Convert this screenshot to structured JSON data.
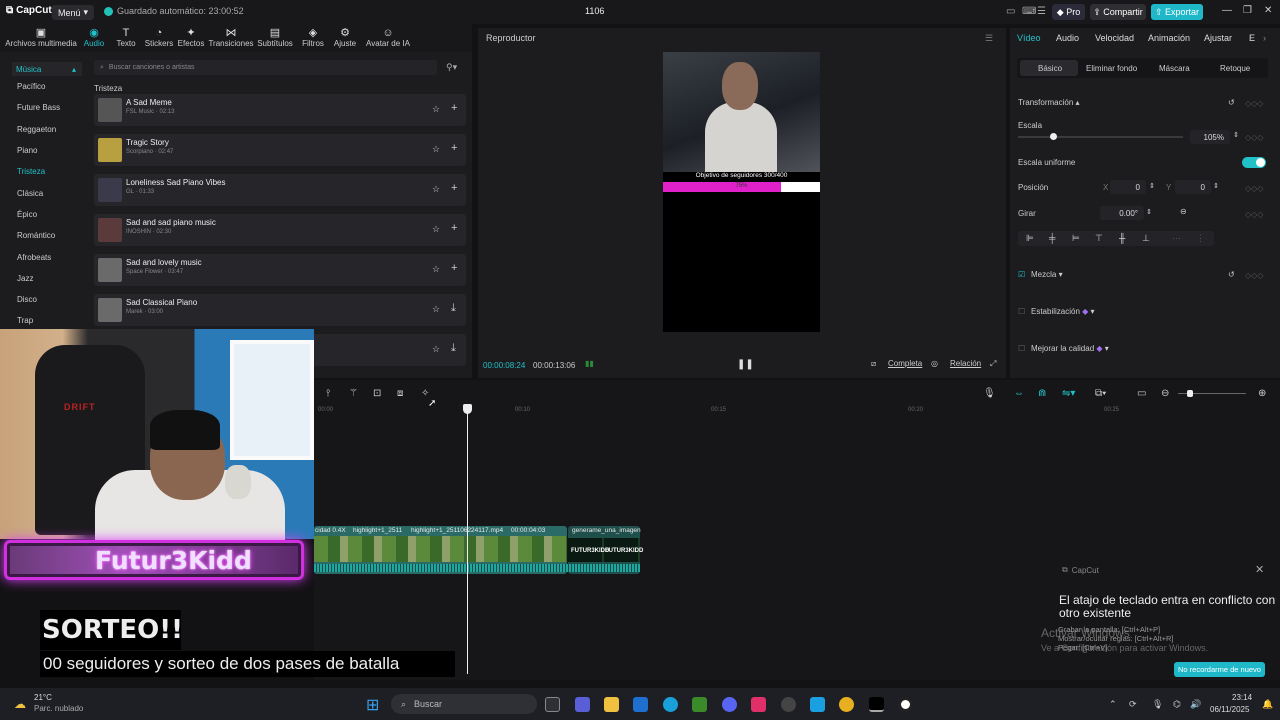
{
  "app": {
    "logo": "CapCut",
    "menu_label": "Menú",
    "autosave": "Guardado automático: 23:00:52",
    "project_title": "1106",
    "pro_label": "Pro",
    "share_label": "Compartir",
    "export_label": "Exportar",
    "accent": "#22c1c8"
  },
  "toolbar": {
    "items": [
      {
        "label": "Archivos multimedia",
        "icon": "media-icon"
      },
      {
        "label": "Audio",
        "icon": "audio-icon"
      },
      {
        "label": "Texto",
        "icon": "text-icon"
      },
      {
        "label": "Stickers",
        "icon": "sticker-icon"
      },
      {
        "label": "Efectos",
        "icon": "effects-icon"
      },
      {
        "label": "Transiciones",
        "icon": "transitions-icon"
      },
      {
        "label": "Subtítulos",
        "icon": "subtitles-icon"
      },
      {
        "label": "Filtros",
        "icon": "filters-icon"
      },
      {
        "label": "Ajuste",
        "icon": "adjust-icon"
      },
      {
        "label": "Avatar de IA",
        "icon": "ai-avatar-icon"
      }
    ]
  },
  "sidebar": {
    "music_label": "Música",
    "categories": [
      "Pacífico",
      "Future Bass",
      "Reggaeton",
      "Piano",
      "Tristeza",
      "Clásica",
      "Épico",
      "Romántico",
      "Afrobeats",
      "Jazz",
      "Disco",
      "Trap"
    ]
  },
  "library": {
    "search_placeholder": "Buscar canciones o artistas",
    "section": "Tristeza",
    "tracks": [
      {
        "title": "A Sad Meme",
        "meta": "FSL Music · 02:13"
      },
      {
        "title": "Tragic Story",
        "meta": "Scorpiano · 02:47"
      },
      {
        "title": "Loneliness Sad Piano Vibes",
        "meta": "GL · 01:33"
      },
      {
        "title": "Sad and sad piano music",
        "meta": "INOSHIN · 02:30"
      },
      {
        "title": "Sad and lovely music",
        "meta": "Space Flower · 03:47"
      },
      {
        "title": "Sad Classical Piano",
        "meta": "Marek · 03:00"
      }
    ]
  },
  "player": {
    "title": "Reproductor",
    "overlay_goal": "Objetivo de seguidores 300/400",
    "goal_progress": 0.75,
    "goal_percent": "75%",
    "time_current": "00:00:08:24",
    "time_total": "00:00:13:06",
    "btn_complete": "Completa",
    "btn_ratio": "Relación"
  },
  "inspector": {
    "tabs": [
      "Vídeo",
      "Audio",
      "Velocidad",
      "Animación",
      "Ajustar",
      "E"
    ],
    "subtabs": [
      "Básico",
      "Eliminar fondo",
      "Máscara",
      "Retoque"
    ],
    "transform_label": "Transformación",
    "scale_label": "Escala",
    "scale_value": "105%",
    "uniform_scale_label": "Escala uniforme",
    "position_label": "Posición",
    "pos_x_label": "X",
    "pos_x": "0",
    "pos_y_label": "Y",
    "pos_y": "0",
    "rotate_label": "Girar",
    "rotate_value": "0.00°",
    "blend_label": "Mezcla",
    "stabilize_label": "Estabilización",
    "quality_label": "Mejorar la calidad"
  },
  "timeline": {
    "ruler": [
      "00:00",
      "00:10",
      "00:15",
      "00:20",
      "00:25"
    ],
    "clip_labels": [
      "cidad 0.4X",
      "highlight+1_2511",
      "highlight+1_251106224117.mp4",
      "00:00:04:03",
      "generame_una_imagen"
    ]
  },
  "overlay": {
    "streamer_name": "Futur3Kidd",
    "headline": "SORTEO!!",
    "caption": "00 seguidores y sorteo de dos pases de batalla",
    "chair_brand": "DRIFT"
  },
  "notification": {
    "app": "CapCut",
    "title": "El atajo de teclado entra en conflicto con otro existente",
    "line1": "Grabar la pantalla: [Ctrl+Alt+P]",
    "line2": "Mostrar/ocultar reglas: [Ctrl+Alt+R]",
    "line3": "Pegar: [Ctrl+V]",
    "button": "No recordarme de nuevo",
    "watermark_title": "Activar Windows",
    "watermark_sub": "Ve a Configuración para activar Windows."
  },
  "taskbar": {
    "temp": "21°C",
    "weather": "Parc. nublado",
    "search_placeholder": "Buscar",
    "time": "23:14",
    "date": "06/11/2025"
  }
}
